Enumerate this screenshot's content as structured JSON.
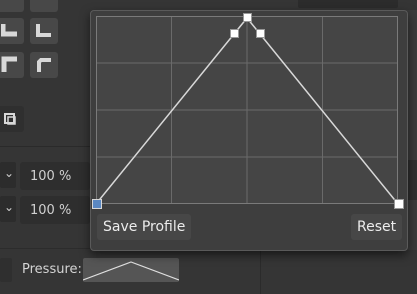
{
  "brush": {
    "size_percent": "100 %",
    "flow_percent": "100 %"
  },
  "pressure": {
    "label": "Pressure:"
  },
  "pressure_popover": {
    "save_profile_label": "Save Profile",
    "reset_label": "Reset"
  },
  "colors": {
    "background": "#353535",
    "popover": "#3e3e3e",
    "graph_background": "#454545",
    "curve": "#d8d8d8",
    "selected_node": "#5b88c2"
  },
  "icons": {
    "tools": [
      "corner-join-icon",
      "corner-join-alt-icon",
      "miter-icon",
      "bevel-icon",
      "frame-icon"
    ],
    "dropdowns": [
      "chevron-down-icon",
      "chevron-down-icon"
    ]
  }
}
